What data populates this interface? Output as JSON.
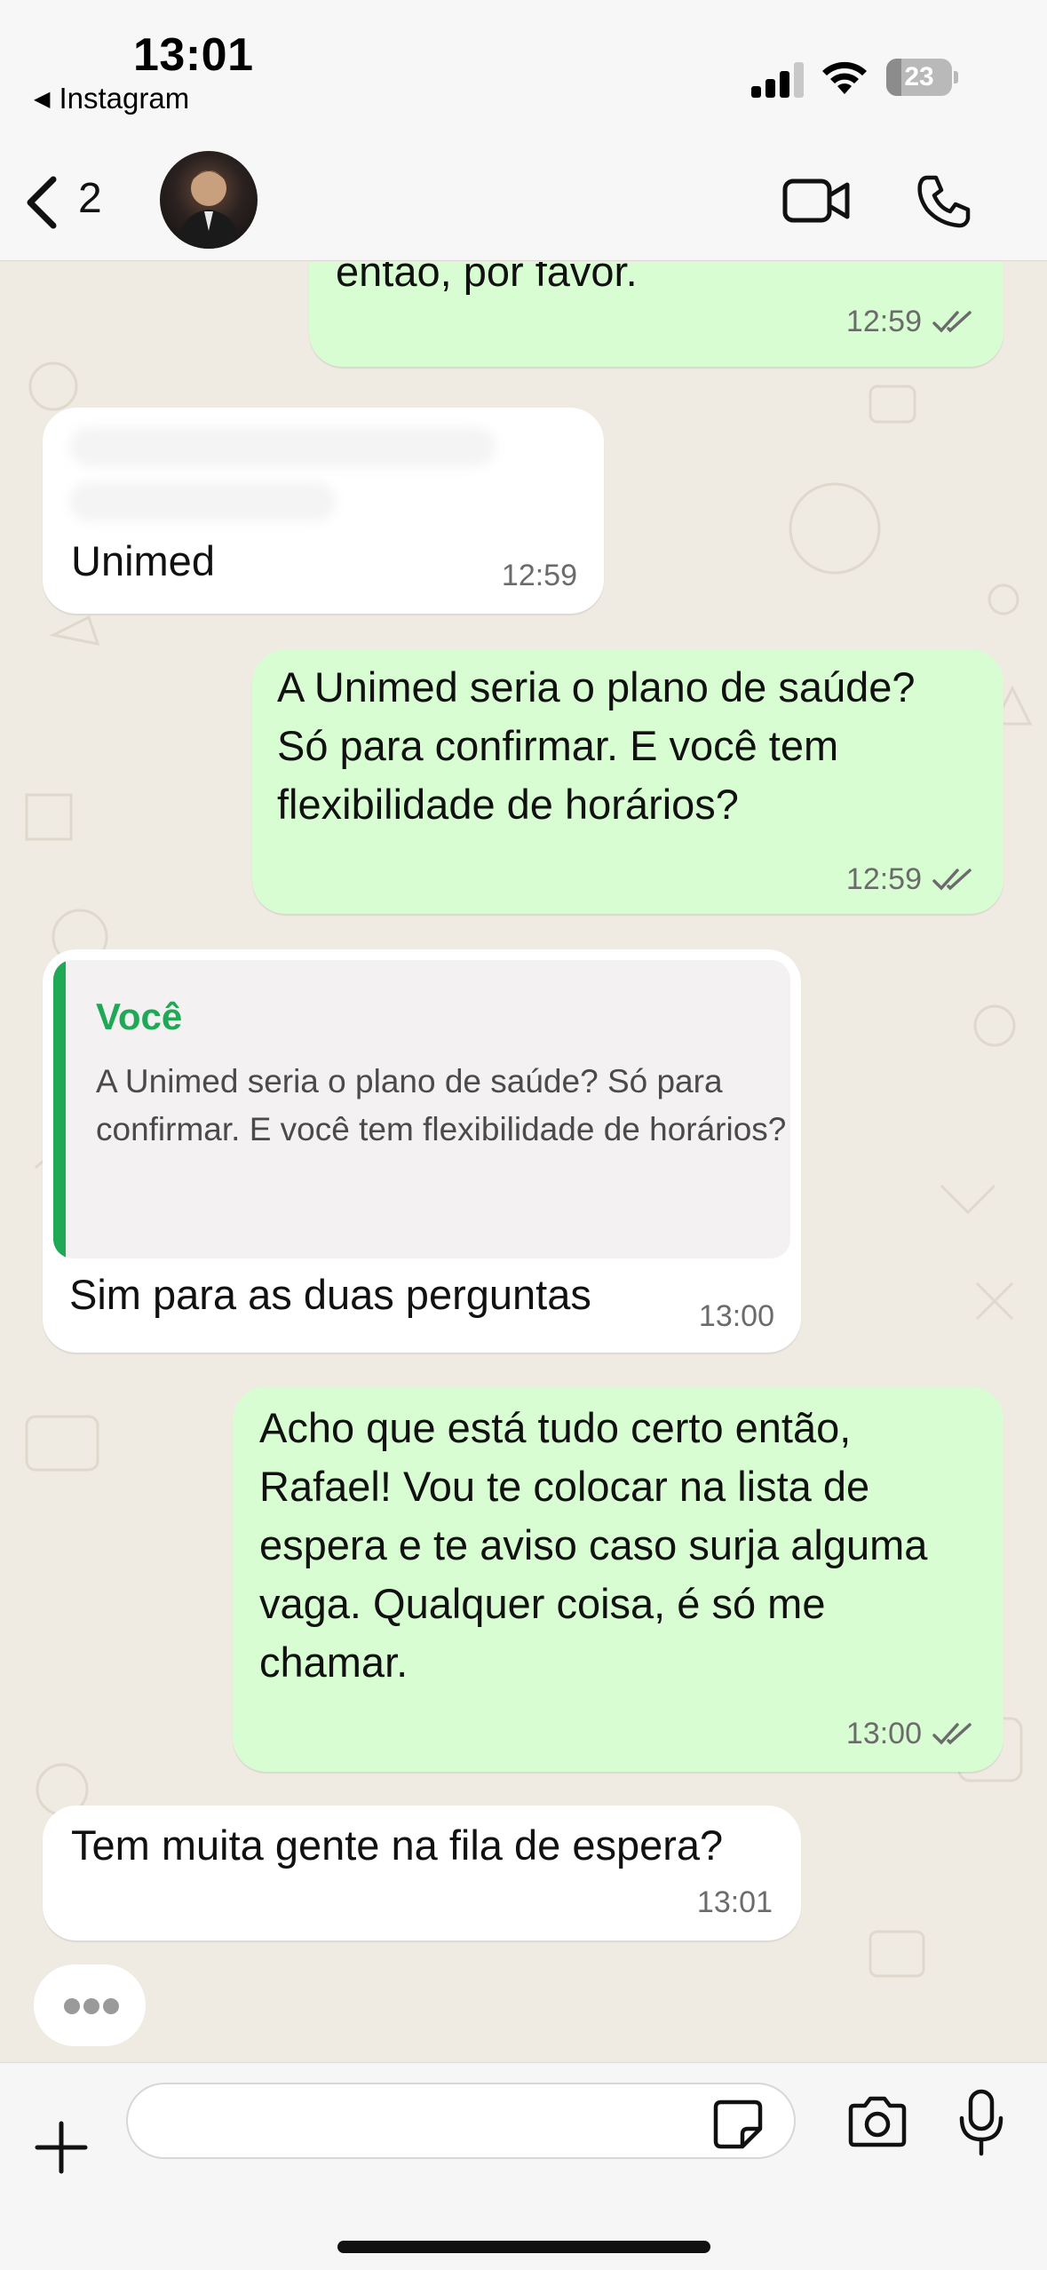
{
  "status_bar": {
    "time": "13:01",
    "back_app": "Instagram",
    "battery": "23",
    "battery_level": 0.23
  },
  "header": {
    "back_count": "2",
    "avatar_icon": "contact-avatar",
    "video_icon": "video-camera-icon",
    "call_icon": "phone-icon"
  },
  "messages": [
    {
      "direction": "outgoing",
      "text": "então, por favor.",
      "time": "12:59",
      "status": "read"
    },
    {
      "direction": "incoming",
      "text": "Unimed",
      "time": "12:59",
      "redacted_lines": 2
    },
    {
      "direction": "outgoing",
      "text": "A Unimed seria o plano de saúde?\nSó para confirmar. E você tem\nflexibilidade de horários?",
      "time": "12:59",
      "status": "read"
    },
    {
      "direction": "incoming",
      "quote": {
        "author": "Você",
        "text": "A Unimed seria o plano de saúde? Só para confirmar. E você tem flexibilidade de horários?"
      },
      "text": "Sim para as duas perguntas",
      "time": "13:00"
    },
    {
      "direction": "outgoing",
      "text": "Acho que está tudo certo então,\nRafael! Vou te colocar na lista de\nespera e te aviso caso surja alguma\nvaga. Qualquer coisa, é só me\nchamar.",
      "time": "13:00",
      "status": "read"
    },
    {
      "direction": "incoming",
      "text": "Tem muita gente na fila de espera?",
      "time": "13:01"
    }
  ],
  "typing_indicator": true,
  "composer": {
    "placeholder": "",
    "value": "",
    "icons": [
      "plus-icon",
      "sticker-icon",
      "camera-icon",
      "microphone-icon"
    ]
  },
  "colors": {
    "outgoing_bubble": "#d9fdd3",
    "incoming_bubble": "#ffffff",
    "chat_background": "#efeae2",
    "quote_accent": "#1fa855",
    "read_ticks": "#6b6b6b"
  }
}
